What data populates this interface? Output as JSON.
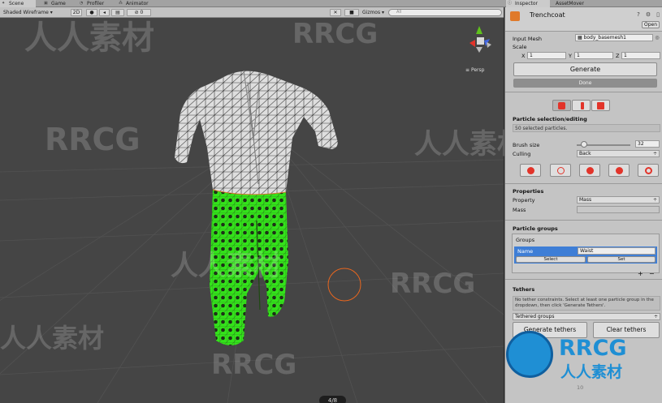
{
  "tabs": {
    "scene": "Scene",
    "game": "Game",
    "profiler": "Profiler",
    "animator": "Animator",
    "inspector": "Inspector",
    "asset_mover": "AssetMover"
  },
  "scene_toolbar": {
    "shading_mode": "Shaded Wireframe",
    "mode_2d": "2D",
    "gizmos": "Gizmos",
    "search_placeholder": "All",
    "gizmo_count": "0"
  },
  "viewport": {
    "camera_label": "Persp",
    "slide_counter": "4/8"
  },
  "inspector": {
    "component_title": "Trenchcoat",
    "open_label": "Open",
    "input_mesh_label": "Input Mesh",
    "input_mesh_value": "body_basemesh1",
    "scale_label": "Scale",
    "scale_x_label": "X",
    "scale_x": "1",
    "scale_y_label": "Y",
    "scale_y": "1",
    "scale_z_label": "Z",
    "scale_z": "1",
    "generate_label": "Generate",
    "done_label": "Done",
    "particle_section_title": "Particle selection/editing",
    "selected_info": "50 selected particles.",
    "brush_size_label": "Brush size",
    "brush_size_value": "32",
    "brush_size_fraction": 0.14,
    "culling_label": "Culling",
    "culling_value": "Back",
    "properties_title": "Properties",
    "property_label": "Property",
    "property_value": "Mass",
    "mass_label": "Mass",
    "mass_value": "",
    "particle_groups_title": "Particle groups",
    "groups_label": "Groups",
    "name_label": "Name",
    "group_name": "Waist",
    "select_label": "Select",
    "set_label": "Set",
    "add_label": "+",
    "remove_label": "−",
    "tethers_title": "Tethers",
    "tethers_info": "No tether constraints. Select at least one particle group in the dropdown, then click 'Generate Tethers'.",
    "tethered_groups_label": "Tethered groups",
    "generate_tethers_label": "Generate tethers",
    "clear_tethers_label": "Clear tethers",
    "bottom_value": "10"
  },
  "watermarks": {
    "text_latin": "RRCG",
    "text_cjk": "人人素材"
  },
  "colors": {
    "selection_green": "#33e31a",
    "mesh_white": "#e6e6e6",
    "wire_dark": "#3a3a3a",
    "brush_ring": "#e8661e",
    "selected_row": "#3e7ed6",
    "logo_blue": "#1f8fd4",
    "gizmo_red": "#e2342a",
    "gizmo_green": "#5fc21c",
    "gizmo_blue": "#3f64e0"
  }
}
